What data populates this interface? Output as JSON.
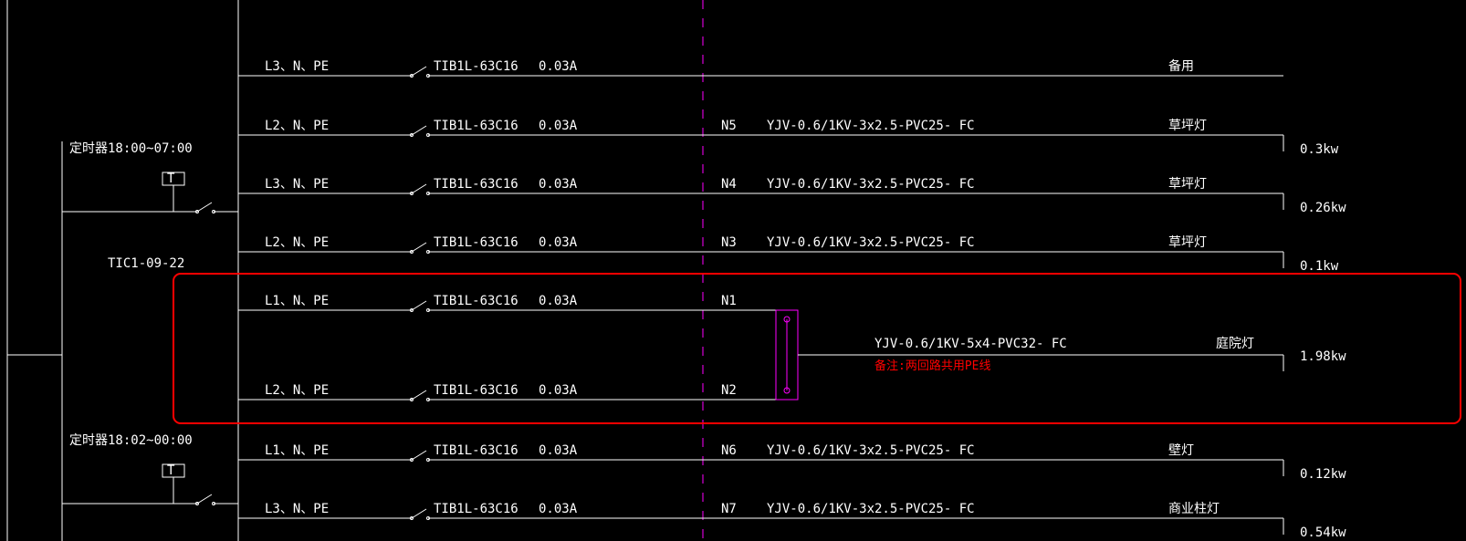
{
  "timer1": {
    "label": "定时器18:00~07:00",
    "t": "T",
    "id": "TIC1-09-22"
  },
  "timer2": {
    "label": "定时器18:02~00:00",
    "t": "T"
  },
  "rows": [
    {
      "phase": "L3、N、PE",
      "breaker": "TIB1L-63C16",
      "amp": "0.03A",
      "cid": "",
      "cable": "",
      "load": "备用",
      "kw": ""
    },
    {
      "phase": "L2、N、PE",
      "breaker": "TIB1L-63C16",
      "amp": "0.03A",
      "cid": "N5",
      "cable": "YJV-0.6/1KV-3x2.5-PVC25- FC",
      "load": "草坪灯",
      "kw": "0.3kw"
    },
    {
      "phase": "L3、N、PE",
      "breaker": "TIB1L-63C16",
      "amp": "0.03A",
      "cid": "N4",
      "cable": "YJV-0.6/1KV-3x2.5-PVC25- FC",
      "load": "草坪灯",
      "kw": "0.26kw"
    },
    {
      "phase": "L2、N、PE",
      "breaker": "TIB1L-63C16",
      "amp": "0.03A",
      "cid": "N3",
      "cable": "YJV-0.6/1KV-3x2.5-PVC25- FC",
      "load": "草坪灯",
      "kw": "0.1kw"
    },
    {
      "phase": "L1、N、PE",
      "breaker": "TIB1L-63C16",
      "amp": "0.03A",
      "cid": "N1",
      "cable": "",
      "load": "",
      "kw": ""
    },
    {
      "phase": "L2、N、PE",
      "breaker": "TIB1L-63C16",
      "amp": "0.03A",
      "cid": "N2",
      "cable": "",
      "load": "",
      "kw": ""
    },
    {
      "phase": "L1、N、PE",
      "breaker": "TIB1L-63C16",
      "amp": "0.03A",
      "cid": "N6",
      "cable": "YJV-0.6/1KV-3x2.5-PVC25- FC",
      "load": "壁灯",
      "kw": "0.12kw"
    },
    {
      "phase": "L3、N、PE",
      "breaker": "TIB1L-63C16",
      "amp": "0.03A",
      "cid": "N7",
      "cable": "YJV-0.6/1KV-3x2.5-PVC25- FC",
      "load": "商业柱灯",
      "kw": "0.54kw"
    }
  ],
  "combined": {
    "cable": "YJV-0.6/1KV-5x4-PVC32- FC",
    "load": "庭院灯",
    "kw": "1.98kw",
    "note": "备注:两回路共用PE线"
  },
  "rowY": [
    83,
    148,
    212,
    276,
    340,
    438,
    504,
    568
  ],
  "layout": {
    "busX": 261,
    "phaseX": 290,
    "swX": 445,
    "brkX": 475,
    "ampX": 590,
    "lineEndX": 1406,
    "cidX": 790,
    "cableX": 840,
    "loadX": 1280,
    "kwX": 1424,
    "combMidY": 389,
    "combBoxX": 850,
    "combBoxW": 24,
    "combLineX": 874
  }
}
